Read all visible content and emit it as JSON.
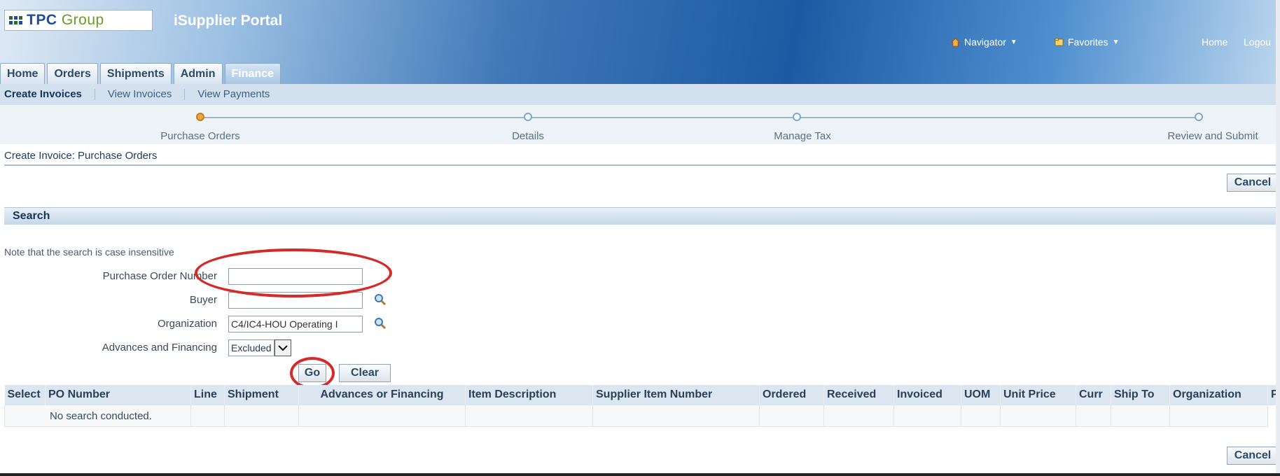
{
  "header": {
    "company": "TPC",
    "company_suffix": "Group",
    "portal_title": "iSupplier Portal",
    "global_links": [
      {
        "label": "Navigator",
        "icon": "home-icon"
      },
      {
        "label": "Favorites",
        "icon": "favorites-icon"
      }
    ],
    "home_link": "Home",
    "logout_link": "Logou"
  },
  "tabs": [
    {
      "label": "Home",
      "active": false
    },
    {
      "label": "Orders",
      "active": false
    },
    {
      "label": "Shipments",
      "active": false
    },
    {
      "label": "Admin",
      "active": false
    },
    {
      "label": "Finance",
      "active": true
    }
  ],
  "subnav": [
    {
      "label": "Create Invoices",
      "current": true
    },
    {
      "label": "View Invoices",
      "current": false
    },
    {
      "label": "View Payments",
      "current": false
    }
  ],
  "train": {
    "current_step": 0,
    "steps": [
      "Purchase Orders",
      "Details",
      "Manage Tax",
      "Review and Submit"
    ]
  },
  "page_title": "Create Invoice: Purchase Orders",
  "cancel_label": "Cancel",
  "search": {
    "heading": "Search",
    "note": "Note that the search is case insensitive",
    "fields": {
      "po_number": {
        "label": "Purchase Order Number",
        "value": ""
      },
      "buyer": {
        "label": "Buyer",
        "value": ""
      },
      "organization": {
        "label": "Organization",
        "value": "C4/IC4-HOU Operating I"
      },
      "advances": {
        "label": "Advances and Financing",
        "value": "Excluded"
      }
    },
    "go_label": "Go",
    "clear_label": "Clear"
  },
  "results": {
    "columns": [
      "Select",
      "PO Number",
      "Line",
      "Shipment",
      "Advances or Financing",
      "Item Description",
      "Supplier Item Number",
      "Ordered",
      "Received",
      "Invoiced",
      "UOM",
      "Unit Price",
      "Curr",
      "Ship To",
      "Organization",
      "Pa"
    ],
    "empty_message": "No search conducted."
  },
  "highlight_color": "#d42a2a"
}
